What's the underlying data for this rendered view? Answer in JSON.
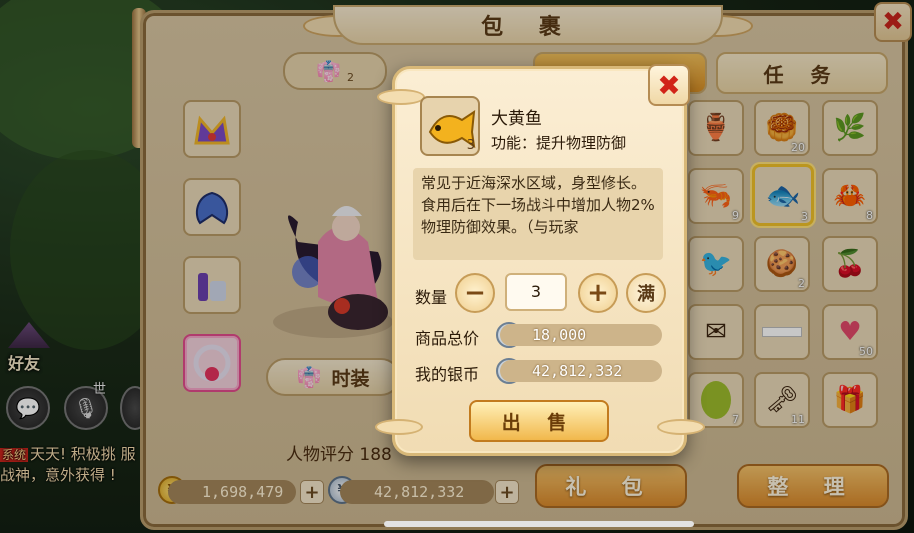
{
  "bag": {
    "title": "包 裹",
    "close_label": "✖",
    "tabs": [
      {
        "label": ""
      },
      {
        "label": "任 务"
      }
    ],
    "fashion_label": "时装",
    "fashion_tab_badge": "2",
    "rating_label": "人物评分 188",
    "gold_value": "1,698,479",
    "silver_value": "42,812,332",
    "plus_label": "+",
    "gift_label": "礼 包",
    "sort_label": "整 理"
  },
  "grid": {
    "items": [
      {
        "name": "bronze-vase",
        "count": ""
      },
      {
        "name": "mooncake-box",
        "count": "20"
      },
      {
        "name": "vine-branch",
        "count": ""
      },
      {
        "name": "shrimp",
        "count": "9"
      },
      {
        "name": "yellow-croaker",
        "count": "3"
      },
      {
        "name": "hermit-crab",
        "count": "8"
      },
      {
        "name": "kingfisher",
        "count": ""
      },
      {
        "name": "pastry-plate",
        "count": "2"
      },
      {
        "name": "fruit-bowl",
        "count": ""
      },
      {
        "name": "envelope",
        "count": ""
      },
      {
        "name": "paper-strip",
        "count": ""
      },
      {
        "name": "heart-card",
        "count": "50"
      },
      {
        "name": "green-bean",
        "count": "7"
      },
      {
        "name": "golden-key",
        "count": "11"
      },
      {
        "name": "gift-box",
        "count": ""
      }
    ]
  },
  "left": {
    "friend_label": "好友",
    "world_tag": "世",
    "chat_tag": "系统",
    "chat_text": "天天! 积极挑 服战神，意外获得 !"
  },
  "popup": {
    "close_label": "✖",
    "item_name": "大黄鱼",
    "item_count": "3",
    "item_function": "功能：提升物理防御",
    "description": "常见于近海深水区域，身型修长。\n食用后在下一场战斗中增加人物2%物理防御效果。（与玩家",
    "quantity_label": "数量",
    "quantity_value": "3",
    "minus_label": "−",
    "plus_label": "+",
    "max_label": "满",
    "total_label": "商品总价",
    "total_value": "18,000",
    "my_silver_label": "我的银币",
    "my_silver_value": "42,812,332",
    "sell_label": "出 售"
  },
  "colors": {
    "accent_gold": "#f0c02a",
    "close_red": "#d12418",
    "panel_bg": "#d9c6a2"
  }
}
